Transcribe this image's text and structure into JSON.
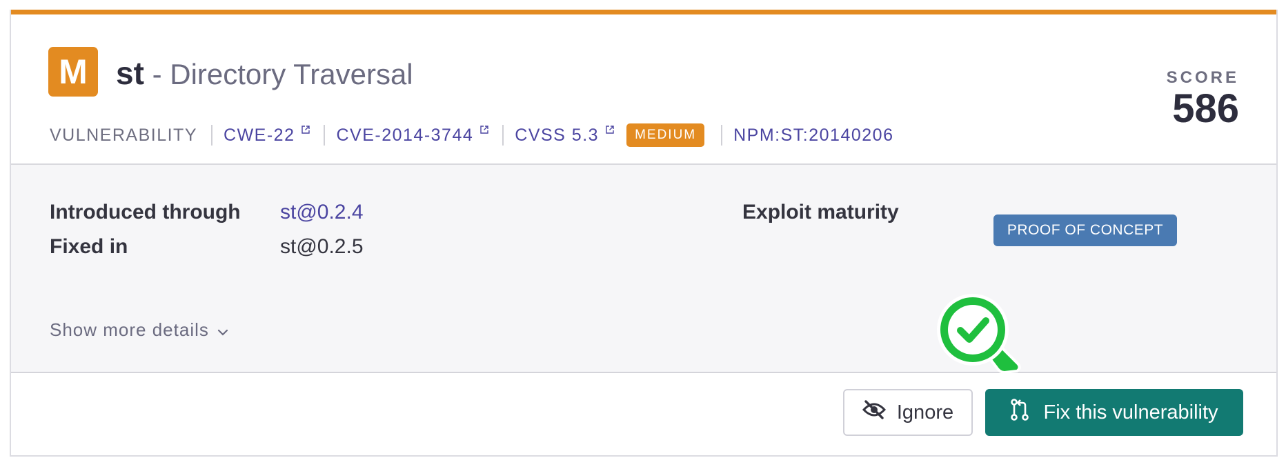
{
  "header": {
    "severity_letter": "M",
    "package": "st",
    "title_separator": " - ",
    "vulnerability_title": "Directory Traversal",
    "type_label": "VULNERABILITY",
    "cwe": "CWE-22",
    "cve": "CVE-2014-3744",
    "cvss": "CVSS 5.3",
    "severity_badge": "MEDIUM",
    "snyk_id": "NPM:ST:20140206",
    "score_label": "SCORE",
    "score_value": "586"
  },
  "details": {
    "introduced_label": "Introduced through",
    "introduced_value": "st@0.2.4",
    "fixed_label": "Fixed in",
    "fixed_value": "st@0.2.5",
    "exploit_label": "Exploit maturity",
    "exploit_value": "PROOF OF CONCEPT",
    "show_more": "Show more details"
  },
  "actions": {
    "ignore_label": "Ignore",
    "fix_label": "Fix this vulnerability"
  },
  "icons": {
    "external": "external-link-icon",
    "chevron": "chevron-down-icon",
    "ignore": "eye-slash-icon",
    "fix": "pull-request-icon",
    "pointer": "check-pin-icon"
  },
  "colors": {
    "severity_orange": "#e38b21",
    "link_purple": "#4b45a1",
    "poc_blue": "#4a7ab2",
    "fix_teal": "#127a72",
    "check_green": "#1fbf3e"
  }
}
